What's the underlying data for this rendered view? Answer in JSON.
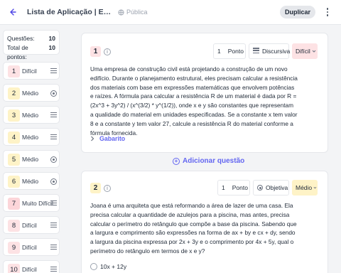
{
  "header": {
    "back_icon": "arrow-left-icon",
    "title": "Lista de Aplicação | Expressões Algébricas",
    "visibility": "Pública",
    "visibility_icon": "globe-icon",
    "duplicate_label": "Duplicar",
    "menu_icon": "kebab-icon"
  },
  "summary": {
    "questions_label": "Questões:",
    "questions_value": "10",
    "points_label": "Total de pontos:",
    "points_value": "10"
  },
  "difficulty_colors": {
    "Difícil": "#fde2e4",
    "Médio": "#fef3c7",
    "Muito Difícil": "#fcd5d9"
  },
  "questions_nav": [
    {
      "number": "1",
      "level": "Difícil",
      "icon": "text-lines-icon"
    },
    {
      "number": "2",
      "level": "Médio",
      "icon": "radio-icon"
    },
    {
      "number": "3",
      "level": "Médio",
      "icon": "text-lines-icon"
    },
    {
      "number": "4",
      "level": "Médio",
      "icon": "text-lines-icon"
    },
    {
      "number": "5",
      "level": "Médio",
      "icon": "radio-icon"
    },
    {
      "number": "6",
      "level": "Médio",
      "icon": "radio-icon"
    },
    {
      "number": "7",
      "level": "Muito Difícil",
      "icon": "text-lines-icon"
    },
    {
      "number": "8",
      "level": "Difícil",
      "icon": "text-lines-icon"
    },
    {
      "number": "9",
      "level": "Difícil",
      "icon": "text-lines-icon"
    },
    {
      "number": "10",
      "level": "Difícil",
      "icon": "text-lines-icon"
    }
  ],
  "question1": {
    "number": "1",
    "points_value": "1",
    "points_label": "Ponto",
    "type_label": "Discursiva",
    "type_icon": "text-lines-icon",
    "difficulty": "Difícil",
    "text": "Uma empresa de construção civil está projetando a construção de um novo edifício. Durante o planejamento estrutural, eles precisam calcular a resistência dos materiais com base em expressões matemáticas que envolvem potências e raízes. A fórmula para calcular a resistência R de um material é dada por R = (2x^3 + 3y^2) / (x^(3/2) * y^(1/2)), onde x e y são constantes que representam a qualidade do material em unidades especificadas. Se a constante x tem valor 8 e a constante y tem valor 27, calcule a resistência R do material conforme a fórmula fornecida.",
    "answer_label": "Gabarito"
  },
  "add_question_label": "Adicionar questão",
  "question2": {
    "number": "2",
    "points_value": "1",
    "points_label": "Ponto",
    "type_label": "Objetiva",
    "type_icon": "radio-icon",
    "difficulty": "Médio",
    "text": "Joana é uma arquiteta que está reformando a área de lazer de uma casa. Ela precisa calcular a quantidade de azulejos para a piscina, mas antes, precisa calcular o perímetro do retângulo que compõe a base da piscina. Sabendo que a largura e comprimento são expressões na forma de ax + by e cx + dy, sendo a largura da piscina expressa por 2x + 3y e o comprimento por 4x + 5y, qual o perímetro do retângulo em termos de x e y?",
    "options": [
      "10x + 12y"
    ]
  }
}
